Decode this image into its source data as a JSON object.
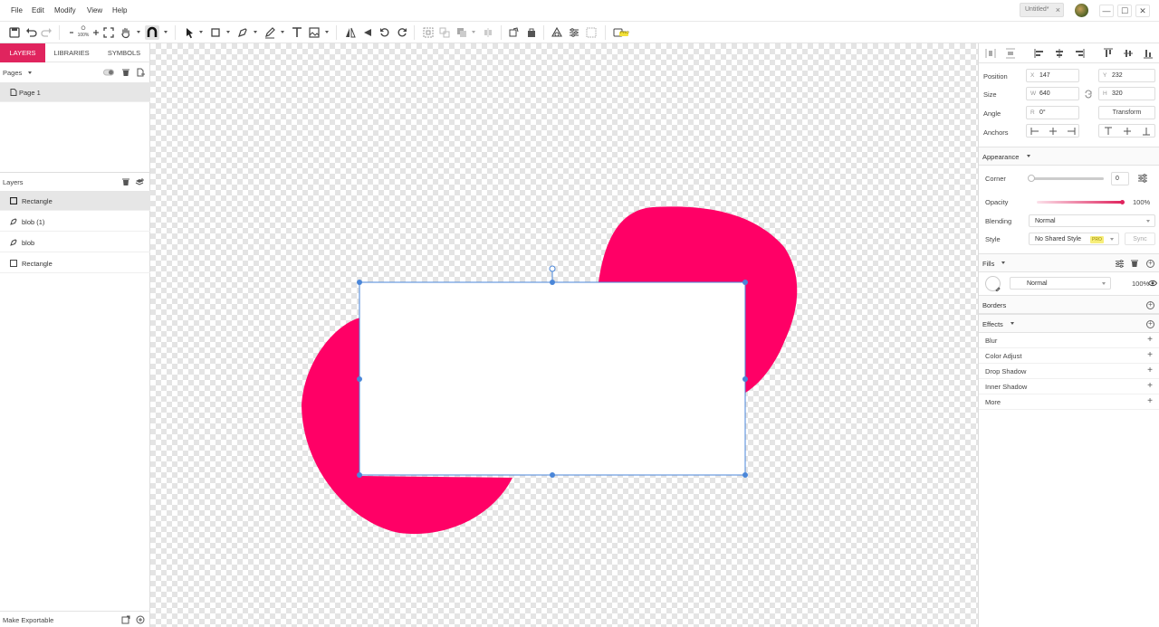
{
  "menu": [
    "File",
    "Edit",
    "Modify",
    "View",
    "Help"
  ],
  "document_tab": {
    "title": "Untitled*",
    "close": "×"
  },
  "window_controls": {
    "minimize": "—",
    "maximize": "☐",
    "close": "✕"
  },
  "toolbar": {
    "zoom_level": "100%",
    "pro_badge": "PRO"
  },
  "left_panel": {
    "tabs": [
      {
        "label": "LAYERS",
        "active": true
      },
      {
        "label": "LIBRARIES",
        "active": false
      },
      {
        "label": "SYMBOLS",
        "active": false
      }
    ],
    "pages_header": "Pages",
    "pages": [
      {
        "label": "Page 1",
        "selected": true
      }
    ],
    "layers_header": "Layers",
    "layers": [
      {
        "label": "Rectangle",
        "type": "rectangle",
        "selected": true
      },
      {
        "label": "blob (1)",
        "type": "path",
        "selected": false
      },
      {
        "label": "blob",
        "type": "path",
        "selected": false
      },
      {
        "label": "Rectangle",
        "type": "rectangle",
        "selected": false
      }
    ],
    "footer": "Make Exportable"
  },
  "canvas": {
    "blob_color": "#ff0066",
    "selection_color": "#4a86d8",
    "rectangle_fill": "#ffffff"
  },
  "inspector": {
    "position_label": "Position",
    "x_prefix": "X",
    "x_value": "147",
    "y_prefix": "Y",
    "y_value": "232",
    "size_label": "Size",
    "w_prefix": "W",
    "w_value": "640",
    "h_prefix": "H",
    "h_value": "320",
    "angle_label": "Angle",
    "r_prefix": "R",
    "angle_value": "0°",
    "transform_button": "Transform",
    "anchors_label": "Anchors",
    "appearance": {
      "title": "Appearance",
      "corner_label": "Corner",
      "corner_value": "0",
      "opacity_label": "Opacity",
      "opacity_value": "100%",
      "blending_label": "Blending",
      "blending_value": "Normal",
      "style_label": "Style",
      "style_value": "No Shared Style",
      "style_badge": "PRO",
      "sync_button": "Sync"
    },
    "fills": {
      "title": "Fills",
      "blend_value": "Normal",
      "opacity_value": "100%"
    },
    "borders": {
      "title": "Borders"
    },
    "effects": {
      "title": "Effects",
      "items": [
        "Blur",
        "Color Adjust",
        "Drop Shadow",
        "Inner Shadow",
        "More"
      ]
    }
  }
}
